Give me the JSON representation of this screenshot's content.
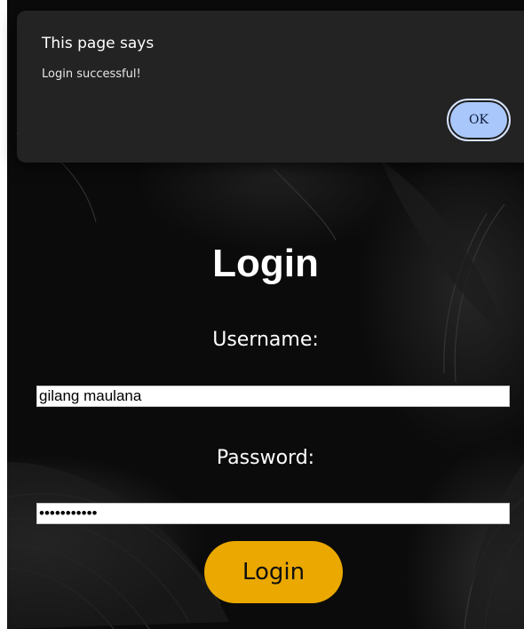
{
  "dialog": {
    "title": "This page says",
    "message": "Login successful!",
    "ok_label": "OK"
  },
  "login_form": {
    "title": "Login",
    "username_label": "Username:",
    "username_value": "gilang maulana",
    "password_label": "Password:",
    "password_value": "gilangmaula",
    "submit_label": "Login"
  },
  "colors": {
    "background": "#0b0b0b",
    "button": "#eaa800",
    "dialog_background": "#232323",
    "ok_button": "#a9c7fa"
  }
}
